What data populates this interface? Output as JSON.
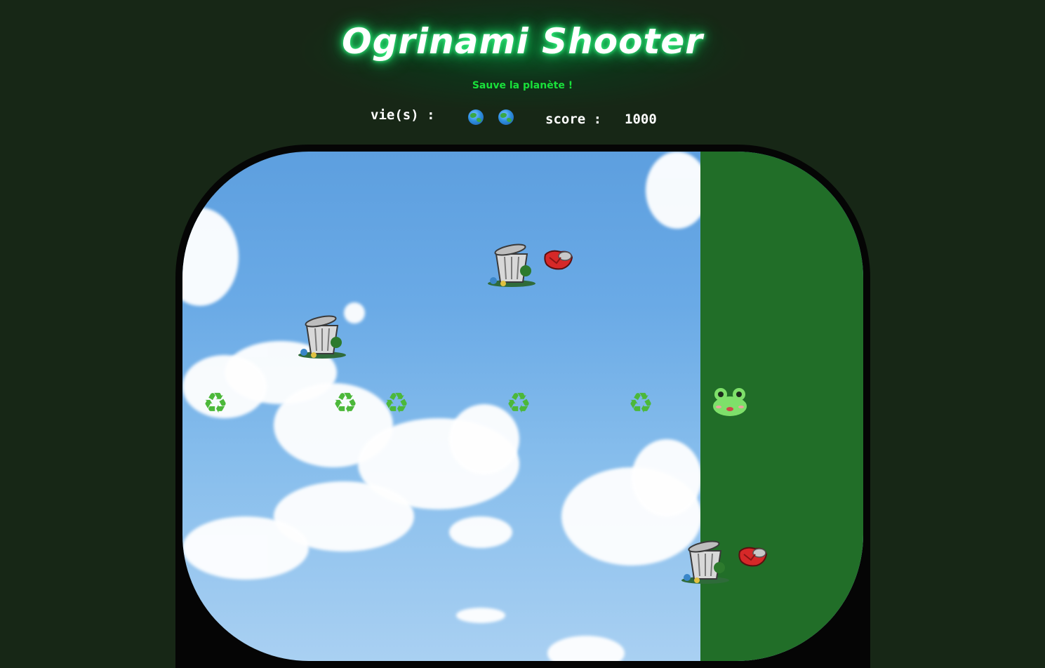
{
  "header": {
    "title": "Ogrinami Shooter",
    "subtitle": "Sauve la planète !"
  },
  "hud": {
    "lives_label": "vie(s) :",
    "lives_count": 2,
    "life_icon": "earth-globe-icon",
    "score_label": "score :",
    "score_value": "1000"
  },
  "game": {
    "background": "sky-with-clouds",
    "accent_grass_color": "#216e28",
    "player_icon": "frog-icon",
    "projectile_icon": "recycle-icon",
    "enemy_icons": [
      "trash-can-icon",
      "crushed-soda-can-icon"
    ],
    "projectile_count": 5,
    "trash_can_count": 3,
    "soda_can_count": 2
  }
}
